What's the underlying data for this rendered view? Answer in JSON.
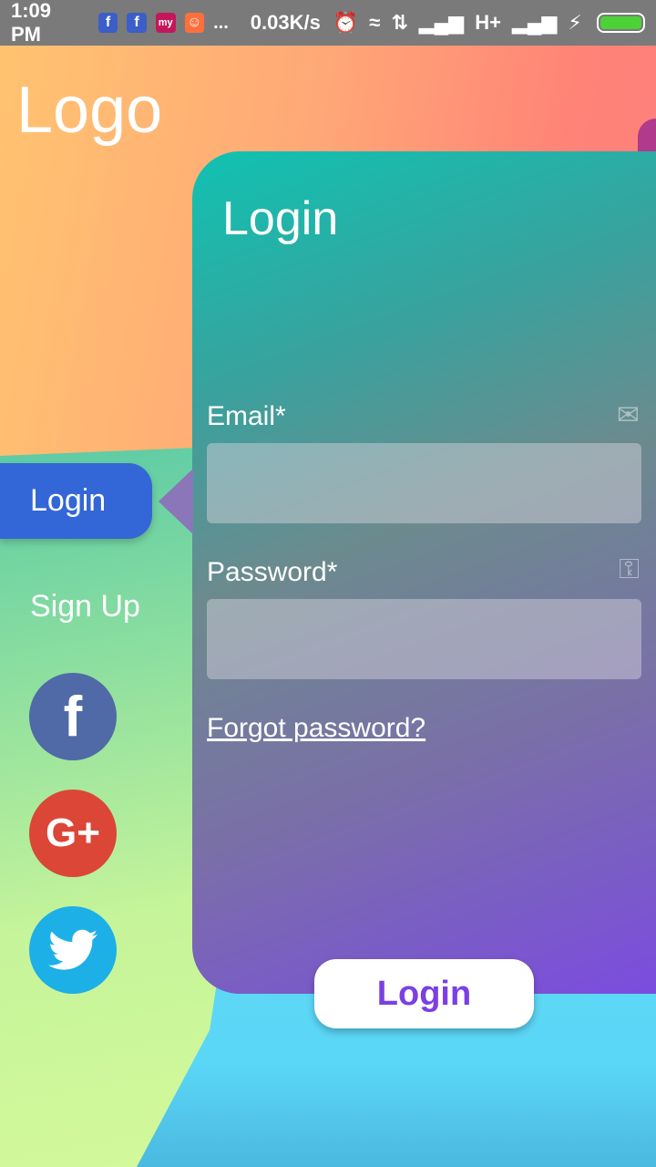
{
  "status_bar": {
    "time": "1:09 PM",
    "notification_icons": [
      "f",
      "f",
      "my",
      "ali"
    ],
    "more": "...",
    "speed": "0.03K/s",
    "network": "H+"
  },
  "logo": "Logo",
  "card": {
    "title": "Login",
    "email_label": "Email*",
    "email_value": "",
    "email_icon": "mail-icon",
    "password_label": "Password*",
    "password_value": "",
    "password_icon": "key-icon",
    "forgot_link": "Forgot password?",
    "submit_label": "Login"
  },
  "side_nav": {
    "login_tab": "Login",
    "signup_tab": "Sign Up"
  },
  "social": {
    "facebook": "f",
    "google_plus": "G+",
    "twitter": "twitter-bird-icon"
  },
  "colors": {
    "active_tab": "#3366d6",
    "button_text": "#7b3fe4",
    "facebook": "#4f6aa6",
    "google_plus": "#dc4637",
    "twitter": "#1cb0e6"
  }
}
